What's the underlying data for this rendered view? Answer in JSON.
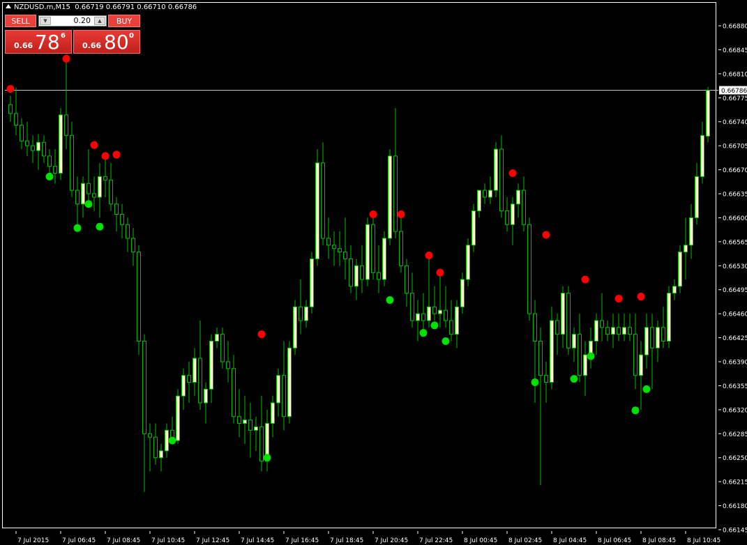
{
  "header": {
    "symbol": "NZDUSD.m,M15",
    "ohlc": "0.66719 0.66791 0.66710 0.66786"
  },
  "trade_panel": {
    "sell_label": "SELL",
    "buy_label": "BUY",
    "lot": "0.20",
    "sell_price": {
      "prefix": "0.66",
      "big": "78",
      "sup": "6"
    },
    "buy_price": {
      "prefix": "0.66",
      "big": "80",
      "sup": "0"
    },
    "color": "#e8413c"
  },
  "colors": {
    "background": "#000000",
    "candle_bull": "#ffffcc",
    "candle_bear": "#000000",
    "wick": "#00c000",
    "price_line": "#c8c8c8",
    "dot_high": "#ff0000",
    "dot_low": "#00e000",
    "axis_text": "#ffffff"
  },
  "chart_data": {
    "type": "candlestick",
    "symbol": "NZDUSD.m",
    "timeframe": "M15",
    "current_price": "0.66786",
    "y_ticks": [
      "0.66880",
      "0.66845",
      "0.66810",
      "0.66775",
      "0.66740",
      "0.66705",
      "0.66670",
      "0.66635",
      "0.66600",
      "0.66565",
      "0.66530",
      "0.66495",
      "0.66460",
      "0.66425",
      "0.66390",
      "0.66355",
      "0.66320",
      "0.66285",
      "0.66250",
      "0.66215",
      "0.66180",
      "0.66145"
    ],
    "y_range": [
      0.66145,
      0.669
    ],
    "x_labels": [
      "7 Jul 2015",
      "7 Jul 06:45",
      "7 Jul 08:45",
      "7 Jul 10:45",
      "7 Jul 12:45",
      "7 Jul 14:45",
      "7 Jul 16:45",
      "7 Jul 18:45",
      "7 Jul 20:45",
      "7 Jul 22:45",
      "8 Jul 00:45",
      "8 Jul 02:45",
      "8 Jul 04:45",
      "8 Jul 06:45",
      "8 Jul 08:45",
      "8 Jul 10:45"
    ],
    "x_label_bars": [
      1,
      9,
      17,
      25,
      33,
      41,
      49,
      57,
      65,
      73,
      81,
      89,
      97,
      105,
      113,
      121
    ],
    "bars": [
      [
        0.66765,
        0.66778,
        0.6674,
        0.66752
      ],
      [
        0.66752,
        0.6679,
        0.6672,
        0.66735
      ],
      [
        0.66735,
        0.66745,
        0.667,
        0.66712
      ],
      [
        0.66712,
        0.6674,
        0.6669,
        0.66705
      ],
      [
        0.66705,
        0.6672,
        0.6668,
        0.66698
      ],
      [
        0.66698,
        0.66722,
        0.6667,
        0.6671
      ],
      [
        0.6671,
        0.6672,
        0.6668,
        0.6669
      ],
      [
        0.6669,
        0.667,
        0.6666,
        0.66675
      ],
      [
        0.66675,
        0.667,
        0.6665,
        0.66665
      ],
      [
        0.66665,
        0.6676,
        0.66655,
        0.6675
      ],
      [
        0.6675,
        0.6683,
        0.667,
        0.6672
      ],
      [
        0.6672,
        0.6674,
        0.6663,
        0.6664
      ],
      [
        0.6664,
        0.6666,
        0.6658,
        0.6662
      ],
      [
        0.6662,
        0.6666,
        0.666,
        0.6665
      ],
      [
        0.6665,
        0.667,
        0.6662,
        0.66635
      ],
      [
        0.66635,
        0.6666,
        0.6661,
        0.6663
      ],
      [
        0.6663,
        0.6668,
        0.666,
        0.6666
      ],
      [
        0.6666,
        0.6669,
        0.6663,
        0.66655
      ],
      [
        0.66655,
        0.6668,
        0.6661,
        0.6662
      ],
      [
        0.6662,
        0.6663,
        0.6658,
        0.66605
      ],
      [
        0.66605,
        0.6662,
        0.6657,
        0.6659
      ],
      [
        0.6659,
        0.666,
        0.6655,
        0.6657
      ],
      [
        0.6657,
        0.66585,
        0.6653,
        0.6655
      ],
      [
        0.6655,
        0.6656,
        0.664,
        0.6642
      ],
      [
        0.6642,
        0.6643,
        0.662,
        0.66285
      ],
      [
        0.66285,
        0.663,
        0.6623,
        0.6628
      ],
      [
        0.6628,
        0.663,
        0.6624,
        0.6625
      ],
      [
        0.6625,
        0.6627,
        0.6623,
        0.6626
      ],
      [
        0.6626,
        0.663,
        0.6625,
        0.6629
      ],
      [
        0.6629,
        0.6631,
        0.6627,
        0.66275
      ],
      [
        0.66275,
        0.6635,
        0.6627,
        0.6634
      ],
      [
        0.6634,
        0.6638,
        0.6632,
        0.6637
      ],
      [
        0.6637,
        0.6639,
        0.6633,
        0.6636
      ],
      [
        0.6636,
        0.6641,
        0.6634,
        0.66395
      ],
      [
        0.66395,
        0.6645,
        0.6632,
        0.6633
      ],
      [
        0.6633,
        0.6636,
        0.663,
        0.6635
      ],
      [
        0.6635,
        0.6643,
        0.6633,
        0.6642
      ],
      [
        0.6642,
        0.6644,
        0.6641,
        0.6643
      ],
      [
        0.6643,
        0.6644,
        0.6638,
        0.6639
      ],
      [
        0.6639,
        0.6642,
        0.6636,
        0.6638
      ],
      [
        0.6638,
        0.664,
        0.663,
        0.6631
      ],
      [
        0.6631,
        0.6635,
        0.6628,
        0.663
      ],
      [
        0.663,
        0.6634,
        0.6627,
        0.66305
      ],
      [
        0.66305,
        0.6633,
        0.6625,
        0.6629
      ],
      [
        0.6629,
        0.6631,
        0.6626,
        0.66295
      ],
      [
        0.66295,
        0.6634,
        0.6623,
        0.66245
      ],
      [
        0.66245,
        0.6632,
        0.6623,
        0.663
      ],
      [
        0.663,
        0.6634,
        0.6628,
        0.6633
      ],
      [
        0.6633,
        0.6638,
        0.6631,
        0.6637
      ],
      [
        0.6637,
        0.6642,
        0.6629,
        0.6631
      ],
      [
        0.6631,
        0.6642,
        0.663,
        0.6641
      ],
      [
        0.6641,
        0.6648,
        0.664,
        0.6647
      ],
      [
        0.6647,
        0.6651,
        0.6643,
        0.6645
      ],
      [
        0.6645,
        0.6648,
        0.6644,
        0.6647
      ],
      [
        0.6647,
        0.6655,
        0.6646,
        0.6654
      ],
      [
        0.6654,
        0.667,
        0.6653,
        0.6668
      ],
      [
        0.6668,
        0.6671,
        0.6656,
        0.6657
      ],
      [
        0.6657,
        0.666,
        0.6654,
        0.6656
      ],
      [
        0.6656,
        0.6658,
        0.6653,
        0.66555
      ],
      [
        0.66555,
        0.6658,
        0.6653,
        0.6655
      ],
      [
        0.6655,
        0.666,
        0.6651,
        0.6654
      ],
      [
        0.6654,
        0.6656,
        0.6649,
        0.665
      ],
      [
        0.665,
        0.6654,
        0.6648,
        0.6653
      ],
      [
        0.6653,
        0.6656,
        0.6649,
        0.6651
      ],
      [
        0.6651,
        0.666,
        0.665,
        0.6659
      ],
      [
        0.6659,
        0.6661,
        0.6651,
        0.6652
      ],
      [
        0.6652,
        0.6656,
        0.6649,
        0.6651
      ],
      [
        0.6651,
        0.6658,
        0.665,
        0.6657
      ],
      [
        0.6657,
        0.667,
        0.6656,
        0.6669
      ],
      [
        0.6669,
        0.6676,
        0.6657,
        0.6658
      ],
      [
        0.6658,
        0.666,
        0.6652,
        0.6653
      ],
      [
        0.6653,
        0.6654,
        0.6647,
        0.6649
      ],
      [
        0.6649,
        0.6652,
        0.6644,
        0.6645
      ],
      [
        0.6645,
        0.6648,
        0.6642,
        0.6646
      ],
      [
        0.6646,
        0.6649,
        0.6643,
        0.6645
      ],
      [
        0.6645,
        0.6654,
        0.6644,
        0.6647
      ],
      [
        0.6647,
        0.665,
        0.6645,
        0.6646
      ],
      [
        0.6646,
        0.6652,
        0.6644,
        0.66465
      ],
      [
        0.66465,
        0.665,
        0.6644,
        0.6645
      ],
      [
        0.6645,
        0.6648,
        0.6642,
        0.6643
      ],
      [
        0.6643,
        0.6648,
        0.6641,
        0.6647
      ],
      [
        0.6647,
        0.6652,
        0.6646,
        0.6651
      ],
      [
        0.6651,
        0.6657,
        0.665,
        0.6656
      ],
      [
        0.6656,
        0.6662,
        0.6655,
        0.6661
      ],
      [
        0.6661,
        0.6664,
        0.666,
        0.6664
      ],
      [
        0.6664,
        0.6665,
        0.6662,
        0.6663
      ],
      [
        0.6663,
        0.6666,
        0.6662,
        0.6664
      ],
      [
        0.6664,
        0.6671,
        0.6663,
        0.667
      ],
      [
        0.667,
        0.6672,
        0.666,
        0.6661
      ],
      [
        0.6661,
        0.6663,
        0.6658,
        0.6659
      ],
      [
        0.6659,
        0.6663,
        0.6656,
        0.6662
      ],
      [
        0.6662,
        0.6665,
        0.666,
        0.6664
      ],
      [
        0.6664,
        0.6666,
        0.6658,
        0.6659
      ],
      [
        0.6659,
        0.666,
        0.6645,
        0.6646
      ],
      [
        0.6646,
        0.6648,
        0.6633,
        0.6642
      ],
      [
        0.6642,
        0.6644,
        0.6621,
        0.6637
      ],
      [
        0.6637,
        0.6639,
        0.6633,
        0.6636
      ],
      [
        0.6636,
        0.6647,
        0.6635,
        0.6645
      ],
      [
        0.6645,
        0.6646,
        0.664,
        0.6643
      ],
      [
        0.6643,
        0.665,
        0.6641,
        0.6649
      ],
      [
        0.6649,
        0.665,
        0.664,
        0.6641
      ],
      [
        0.6641,
        0.6644,
        0.6639,
        0.6643
      ],
      [
        0.6643,
        0.6646,
        0.6636,
        0.6637
      ],
      [
        0.6637,
        0.6642,
        0.6634,
        0.664
      ],
      [
        0.664,
        0.6644,
        0.6638,
        0.6642
      ],
      [
        0.6642,
        0.6646,
        0.664,
        0.6645
      ],
      [
        0.6645,
        0.6649,
        0.6642,
        0.6644
      ],
      [
        0.6644,
        0.6645,
        0.6642,
        0.6643
      ],
      [
        0.6643,
        0.6646,
        0.6641,
        0.6644
      ],
      [
        0.6644,
        0.6646,
        0.6642,
        0.6643
      ],
      [
        0.6643,
        0.6646,
        0.6642,
        0.6644
      ],
      [
        0.6644,
        0.6646,
        0.6642,
        0.6643
      ],
      [
        0.6643,
        0.6646,
        0.6635,
        0.6637
      ],
      [
        0.6637,
        0.6642,
        0.6632,
        0.664
      ],
      [
        0.664,
        0.6646,
        0.6638,
        0.6644
      ],
      [
        0.6644,
        0.6646,
        0.6635,
        0.6641
      ],
      [
        0.6641,
        0.6645,
        0.6639,
        0.6644
      ],
      [
        0.6644,
        0.6647,
        0.6641,
        0.6642
      ],
      [
        0.6642,
        0.665,
        0.6641,
        0.6649
      ],
      [
        0.6649,
        0.6651,
        0.6648,
        0.665
      ],
      [
        0.665,
        0.6656,
        0.6649,
        0.6655
      ],
      [
        0.6655,
        0.666,
        0.6651,
        0.6656
      ],
      [
        0.6656,
        0.6662,
        0.6654,
        0.666
      ],
      [
        0.666,
        0.6668,
        0.6659,
        0.6666
      ],
      [
        0.6666,
        0.6674,
        0.6665,
        0.6672
      ],
      [
        0.66719,
        0.66791,
        0.6671,
        0.66786
      ]
    ],
    "high_dots": [
      [
        0,
        0.66788
      ],
      [
        10,
        0.66832
      ],
      [
        15,
        0.66706
      ],
      [
        17,
        0.6669
      ],
      [
        19,
        0.66692
      ],
      [
        45,
        0.6643
      ],
      [
        65,
        0.66605
      ],
      [
        70,
        0.66605
      ],
      [
        75,
        0.66545
      ],
      [
        77,
        0.6652
      ],
      [
        90,
        0.66665
      ],
      [
        96,
        0.66575
      ],
      [
        103,
        0.6651
      ],
      [
        109,
        0.66482
      ],
      [
        113,
        0.66485
      ]
    ],
    "low_dots": [
      [
        7,
        0.6666
      ],
      [
        12,
        0.66585
      ],
      [
        14,
        0.6662
      ],
      [
        16,
        0.66587
      ],
      [
        29,
        0.66275
      ],
      [
        46,
        0.6625
      ],
      [
        68,
        0.6648
      ],
      [
        74,
        0.66432
      ],
      [
        76,
        0.66443
      ],
      [
        78,
        0.6642
      ],
      [
        94,
        0.6636
      ],
      [
        101,
        0.66365
      ],
      [
        104,
        0.66398
      ],
      [
        112,
        0.66319
      ],
      [
        114,
        0.6635
      ]
    ]
  }
}
